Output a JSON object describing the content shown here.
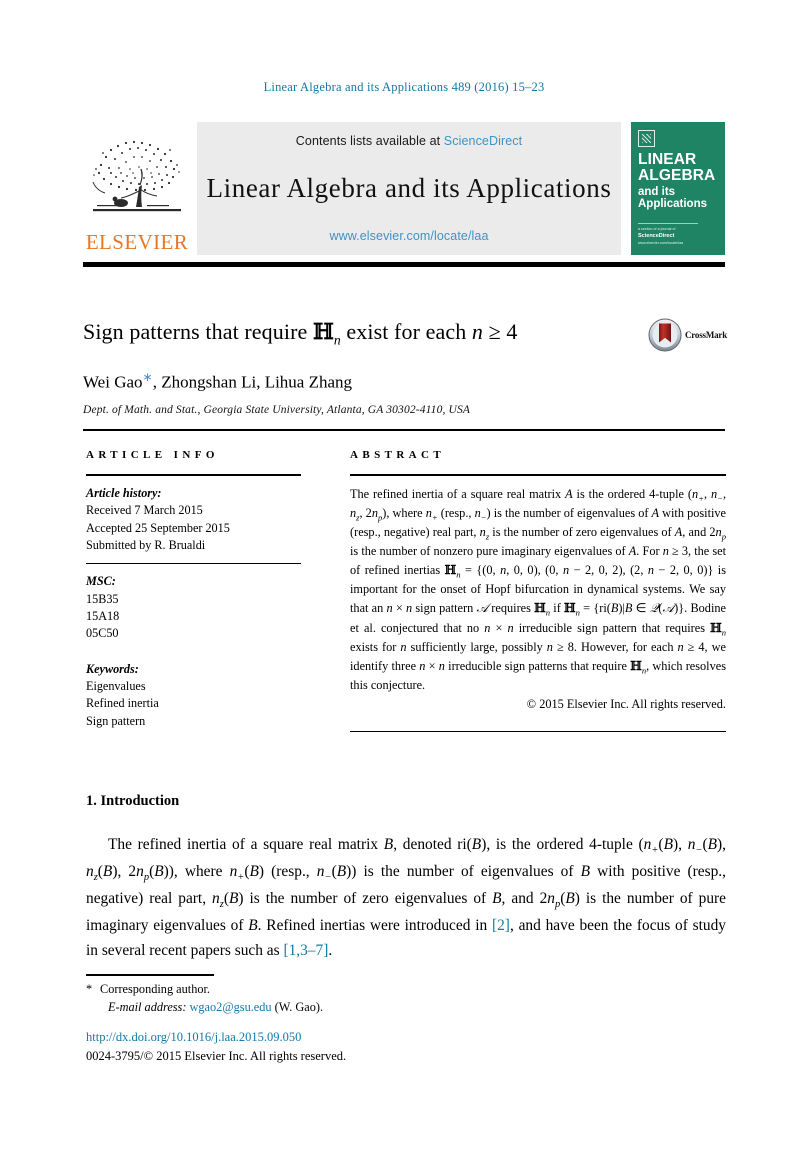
{
  "running_head": "Linear Algebra and its Applications 489 (2016) 15–23",
  "masthead": {
    "contents_prefix": "Contents lists available at ",
    "sciencedirect": "ScienceDirect",
    "journal_title": "Linear Algebra and its Applications",
    "journal_url": "www.elsevier.com/locate/laa",
    "publisher_wordmark": "ELSEVIER",
    "cover": {
      "line1": "LINEAR",
      "line2": "ALGEBRA",
      "line3": "and its",
      "line4": "Applications",
      "footer_top": "a section of a journal of",
      "footer_mid": "ScienceDirect",
      "footer_bottom": "www.elsevier.com/locate/laa"
    }
  },
  "colors": {
    "link_blue": "#1379a7",
    "sd_blue": "#3e93c6",
    "elsevier_orange": "#e87722",
    "cover_green": "#1f8463",
    "crossmark_red": "#a32021",
    "band_gray": "#ebebeb"
  },
  "title": {
    "part1": "Sign patterns that require ",
    "blackboard_h": "ℍ",
    "subscript_n": "n",
    "part2": " exist for each ",
    "var_n": "n",
    "relation": " ≥ 4"
  },
  "authors": {
    "a1": "Wei Gao",
    "star": "∗",
    "rest": ", Zhongshan Li, Lihua Zhang",
    "affiliation": "Dept. of Math. and Stat., Georgia State University, Atlanta, GA 30302-4110, USA"
  },
  "crossmark": {
    "label": "CrossMark"
  },
  "article_info": {
    "heading": "ARTICLE INFO",
    "history_heading": "Article history:",
    "history": [
      "Received 7 March 2015",
      "Accepted 25 September 2015",
      "Submitted by R. Brualdi"
    ],
    "msc_heading": "MSC:",
    "msc": [
      "15B35",
      "15A18",
      "05C50"
    ],
    "keywords_heading": "Keywords:",
    "keywords": [
      "Eigenvalues",
      "Refined inertia",
      "Sign pattern"
    ]
  },
  "abstract": {
    "heading": "ABSTRACT",
    "text_html": "The refined inertia of a square real matrix <span class=\"it\">A</span> is the ordered 4-tuple (<span class=\"it\">n</span><sub>+</sub>, <span class=\"it\">n</span><sub>−</sub>, <span class=\"it\">n</span><sub>z</sub>, 2<span class=\"it\">n</span><sub>p</sub>), where <span class=\"it\">n</span><sub>+</sub> (resp., <span class=\"it\">n</span><sub>−</sub>) is the number of eigenvalues of <span class=\"it\">A</span> with positive (resp., negative) real part, <span class=\"it\">n</span><sub>z</sub> is the number of zero eigenvalues of <span class=\"it\">A</span>, and 2<span class=\"it\">n</span><sub>p</sub> is the number of nonzero pure imaginary eigenvalues of <span class=\"it\">A</span>. For <span class=\"it\">n</span> ≥ 3, the set of refined inertias <span class=\"bb\">ℍ</span><sub>n</sub> = {(0, <span class=\"it\">n</span>, 0, 0), (0, <span class=\"it\">n</span> − 2, 0, 2), (2, <span class=\"it\">n</span> − 2, 0, 0)} is important for the onset of Hopf bifurcation in dynamical systems. We say that an <span class=\"it\">n</span> × <span class=\"it\">n</span> sign pattern <span class=\"it\">𝒜</span> requires <span class=\"bb\">ℍ</span><sub>n</sub> if <span class=\"bb\">ℍ</span><sub>n</sub> = {ri(<span class=\"it\">B</span>)|<span class=\"it\">B</span> ∈ <span class=\"it\">𝒬</span>(<span class=\"it\">𝒜</span>)}. Bodine et al. conjectured that no <span class=\"it\">n</span> × <span class=\"it\">n</span> irreducible sign pattern that requires <span class=\"bb\">ℍ</span><sub>n</sub> exists for <span class=\"it\">n</span> sufficiently large, possibly <span class=\"it\">n</span> ≥ 8. However, for each <span class=\"it\">n</span> ≥ 4, we identify three <span class=\"it\">n</span> × <span class=\"it\">n</span> irreducible sign patterns that require <span class=\"bb\">ℍ</span><sub>n</sub>, which resolves this conjecture.",
    "copyright": "© 2015 Elsevier Inc. All rights reserved."
  },
  "body": {
    "section_heading": "1. Introduction",
    "paragraph_html": "The refined inertia of a square real matrix <span class=\"it\">B</span>, denoted ri(<span class=\"it\">B</span>), is the ordered 4-tuple (<span class=\"it\">n</span><sub>+</sub>(<span class=\"it\">B</span>), <span class=\"it\">n</span><sub>−</sub>(<span class=\"it\">B</span>), <span class=\"it\">n</span><sub>z</sub>(<span class=\"it\">B</span>), 2<span class=\"it\">n</span><sub>p</sub>(<span class=\"it\">B</span>)), where <span class=\"it\">n</span><sub>+</sub>(<span class=\"it\">B</span>) (resp., <span class=\"it\">n</span><sub>−</sub>(<span class=\"it\">B</span>)) is the number of eigenvalues of <span class=\"it\">B</span> with positive (resp., negative) real part, <span class=\"it\">n</span><sub>z</sub>(<span class=\"it\">B</span>) is the number of zero eigenvalues of <span class=\"it\">B</span>, and 2<span class=\"it\">n</span><sub>p</sub>(<span class=\"it\">B</span>) is the number of pure imaginary eigenvalues of <span class=\"it\">B</span>. Refined inertias were introduced in <span class=\"ref-link\">[2]</span>, and have been the focus of study in several recent papers such as <span class=\"ref-link\">[1,3–7]</span>."
  },
  "footnote": {
    "star": "*",
    "corresponding": "Corresponding author.",
    "email_label": "E-mail address:",
    "email": "wgao2@gsu.edu",
    "email_suffix": "(W. Gao)."
  },
  "footer": {
    "doi": "http://dx.doi.org/10.1016/j.laa.2015.09.050",
    "issn_line": "0024-3795/© 2015 Elsevier Inc. All rights reserved."
  }
}
